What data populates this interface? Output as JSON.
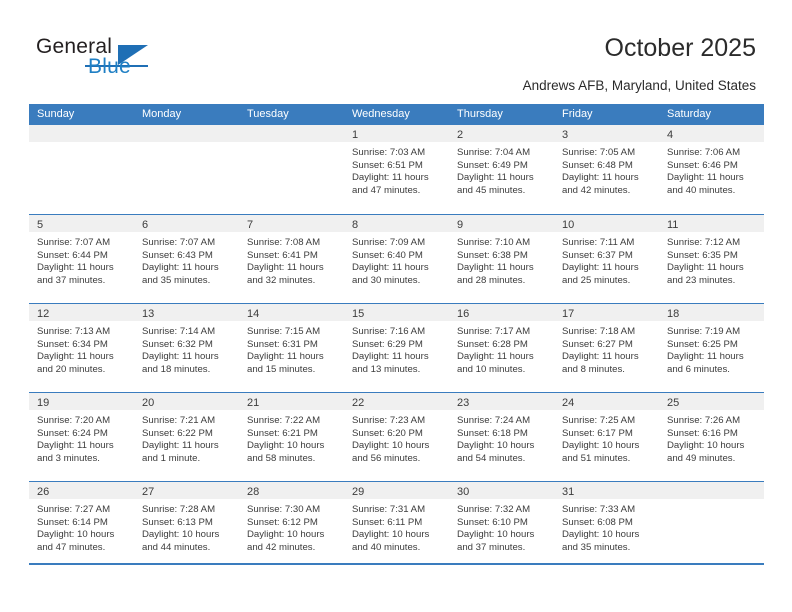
{
  "brand": {
    "name_top": "General",
    "name_bottom": "Blue",
    "accent_color": "#1f6fb5",
    "logo_icon": "triangle-flag-icon"
  },
  "header": {
    "title": "October 2025",
    "subtitle": "Andrews AFB, Maryland, United States"
  },
  "calendar": {
    "header_bg": "#3a7cbe",
    "daynum_bg": "#f0f0f0",
    "weekdays": [
      "Sunday",
      "Monday",
      "Tuesday",
      "Wednesday",
      "Thursday",
      "Friday",
      "Saturday"
    ],
    "weeks": [
      [
        {
          "day": "",
          "empty": true
        },
        {
          "day": "",
          "empty": true
        },
        {
          "day": "",
          "empty": true
        },
        {
          "day": "1",
          "sunrise": "Sunrise: 7:03 AM",
          "sunset": "Sunset: 6:51 PM",
          "daylight1": "Daylight: 11 hours",
          "daylight2": "and 47 minutes."
        },
        {
          "day": "2",
          "sunrise": "Sunrise: 7:04 AM",
          "sunset": "Sunset: 6:49 PM",
          "daylight1": "Daylight: 11 hours",
          "daylight2": "and 45 minutes."
        },
        {
          "day": "3",
          "sunrise": "Sunrise: 7:05 AM",
          "sunset": "Sunset: 6:48 PM",
          "daylight1": "Daylight: 11 hours",
          "daylight2": "and 42 minutes."
        },
        {
          "day": "4",
          "sunrise": "Sunrise: 7:06 AM",
          "sunset": "Sunset: 6:46 PM",
          "daylight1": "Daylight: 11 hours",
          "daylight2": "and 40 minutes."
        }
      ],
      [
        {
          "day": "5",
          "sunrise": "Sunrise: 7:07 AM",
          "sunset": "Sunset: 6:44 PM",
          "daylight1": "Daylight: 11 hours",
          "daylight2": "and 37 minutes."
        },
        {
          "day": "6",
          "sunrise": "Sunrise: 7:07 AM",
          "sunset": "Sunset: 6:43 PM",
          "daylight1": "Daylight: 11 hours",
          "daylight2": "and 35 minutes."
        },
        {
          "day": "7",
          "sunrise": "Sunrise: 7:08 AM",
          "sunset": "Sunset: 6:41 PM",
          "daylight1": "Daylight: 11 hours",
          "daylight2": "and 32 minutes."
        },
        {
          "day": "8",
          "sunrise": "Sunrise: 7:09 AM",
          "sunset": "Sunset: 6:40 PM",
          "daylight1": "Daylight: 11 hours",
          "daylight2": "and 30 minutes."
        },
        {
          "day": "9",
          "sunrise": "Sunrise: 7:10 AM",
          "sunset": "Sunset: 6:38 PM",
          "daylight1": "Daylight: 11 hours",
          "daylight2": "and 28 minutes."
        },
        {
          "day": "10",
          "sunrise": "Sunrise: 7:11 AM",
          "sunset": "Sunset: 6:37 PM",
          "daylight1": "Daylight: 11 hours",
          "daylight2": "and 25 minutes."
        },
        {
          "day": "11",
          "sunrise": "Sunrise: 7:12 AM",
          "sunset": "Sunset: 6:35 PM",
          "daylight1": "Daylight: 11 hours",
          "daylight2": "and 23 minutes."
        }
      ],
      [
        {
          "day": "12",
          "sunrise": "Sunrise: 7:13 AM",
          "sunset": "Sunset: 6:34 PM",
          "daylight1": "Daylight: 11 hours",
          "daylight2": "and 20 minutes."
        },
        {
          "day": "13",
          "sunrise": "Sunrise: 7:14 AM",
          "sunset": "Sunset: 6:32 PM",
          "daylight1": "Daylight: 11 hours",
          "daylight2": "and 18 minutes."
        },
        {
          "day": "14",
          "sunrise": "Sunrise: 7:15 AM",
          "sunset": "Sunset: 6:31 PM",
          "daylight1": "Daylight: 11 hours",
          "daylight2": "and 15 minutes."
        },
        {
          "day": "15",
          "sunrise": "Sunrise: 7:16 AM",
          "sunset": "Sunset: 6:29 PM",
          "daylight1": "Daylight: 11 hours",
          "daylight2": "and 13 minutes."
        },
        {
          "day": "16",
          "sunrise": "Sunrise: 7:17 AM",
          "sunset": "Sunset: 6:28 PM",
          "daylight1": "Daylight: 11 hours",
          "daylight2": "and 10 minutes."
        },
        {
          "day": "17",
          "sunrise": "Sunrise: 7:18 AM",
          "sunset": "Sunset: 6:27 PM",
          "daylight1": "Daylight: 11 hours",
          "daylight2": "and 8 minutes."
        },
        {
          "day": "18",
          "sunrise": "Sunrise: 7:19 AM",
          "sunset": "Sunset: 6:25 PM",
          "daylight1": "Daylight: 11 hours",
          "daylight2": "and 6 minutes."
        }
      ],
      [
        {
          "day": "19",
          "sunrise": "Sunrise: 7:20 AM",
          "sunset": "Sunset: 6:24 PM",
          "daylight1": "Daylight: 11 hours",
          "daylight2": "and 3 minutes."
        },
        {
          "day": "20",
          "sunrise": "Sunrise: 7:21 AM",
          "sunset": "Sunset: 6:22 PM",
          "daylight1": "Daylight: 11 hours",
          "daylight2": "and 1 minute."
        },
        {
          "day": "21",
          "sunrise": "Sunrise: 7:22 AM",
          "sunset": "Sunset: 6:21 PM",
          "daylight1": "Daylight: 10 hours",
          "daylight2": "and 58 minutes."
        },
        {
          "day": "22",
          "sunrise": "Sunrise: 7:23 AM",
          "sunset": "Sunset: 6:20 PM",
          "daylight1": "Daylight: 10 hours",
          "daylight2": "and 56 minutes."
        },
        {
          "day": "23",
          "sunrise": "Sunrise: 7:24 AM",
          "sunset": "Sunset: 6:18 PM",
          "daylight1": "Daylight: 10 hours",
          "daylight2": "and 54 minutes."
        },
        {
          "day": "24",
          "sunrise": "Sunrise: 7:25 AM",
          "sunset": "Sunset: 6:17 PM",
          "daylight1": "Daylight: 10 hours",
          "daylight2": "and 51 minutes."
        },
        {
          "day": "25",
          "sunrise": "Sunrise: 7:26 AM",
          "sunset": "Sunset: 6:16 PM",
          "daylight1": "Daylight: 10 hours",
          "daylight2": "and 49 minutes."
        }
      ],
      [
        {
          "day": "26",
          "sunrise": "Sunrise: 7:27 AM",
          "sunset": "Sunset: 6:14 PM",
          "daylight1": "Daylight: 10 hours",
          "daylight2": "and 47 minutes."
        },
        {
          "day": "27",
          "sunrise": "Sunrise: 7:28 AM",
          "sunset": "Sunset: 6:13 PM",
          "daylight1": "Daylight: 10 hours",
          "daylight2": "and 44 minutes."
        },
        {
          "day": "28",
          "sunrise": "Sunrise: 7:30 AM",
          "sunset": "Sunset: 6:12 PM",
          "daylight1": "Daylight: 10 hours",
          "daylight2": "and 42 minutes."
        },
        {
          "day": "29",
          "sunrise": "Sunrise: 7:31 AM",
          "sunset": "Sunset: 6:11 PM",
          "daylight1": "Daylight: 10 hours",
          "daylight2": "and 40 minutes."
        },
        {
          "day": "30",
          "sunrise": "Sunrise: 7:32 AM",
          "sunset": "Sunset: 6:10 PM",
          "daylight1": "Daylight: 10 hours",
          "daylight2": "and 37 minutes."
        },
        {
          "day": "31",
          "sunrise": "Sunrise: 7:33 AM",
          "sunset": "Sunset: 6:08 PM",
          "daylight1": "Daylight: 10 hours",
          "daylight2": "and 35 minutes."
        },
        {
          "day": "",
          "empty": true
        }
      ]
    ]
  }
}
